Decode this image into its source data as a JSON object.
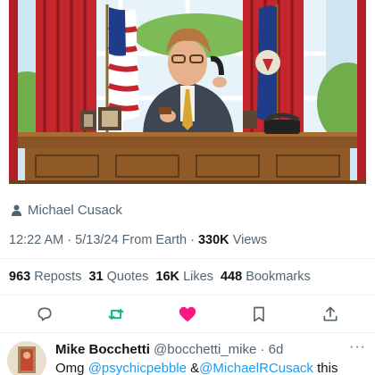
{
  "tweet": {
    "credit_name": "Michael Cusack",
    "time": "12:22 AM",
    "date": "5/13/24",
    "source": "From Earth",
    "views_count": "330K",
    "views_label": "Views",
    "stats": {
      "reposts_count": "963",
      "reposts_label": "Reposts",
      "quotes_count": "31",
      "quotes_label": "Quotes",
      "likes_count": "16K",
      "likes_label": "Likes",
      "bookmarks_count": "448",
      "bookmarks_label": "Bookmarks"
    },
    "actions": {
      "reply_icon": "reply-icon",
      "repost_icon": "repost-icon",
      "repost_color": "#00ba7c",
      "like_icon": "heart-filled-icon",
      "like_color": "#f91880",
      "bookmark_icon": "bookmark-icon",
      "share_icon": "share-icon"
    }
  },
  "reply": {
    "display_name": "Mike Bocchetti",
    "handle": "@bocchetti_mike",
    "separator": "·",
    "time": "6d",
    "more_icon": "···",
    "text_prefix": "Omg",
    "mention_1": "@psychicpebble",
    "text_middle": "&",
    "mention_2": "@MichaelRCusack",
    "text_suffix": "this"
  },
  "colors": {
    "text_primary": "#0f1419",
    "text_secondary": "#536471",
    "link": "#1d9bf0"
  }
}
